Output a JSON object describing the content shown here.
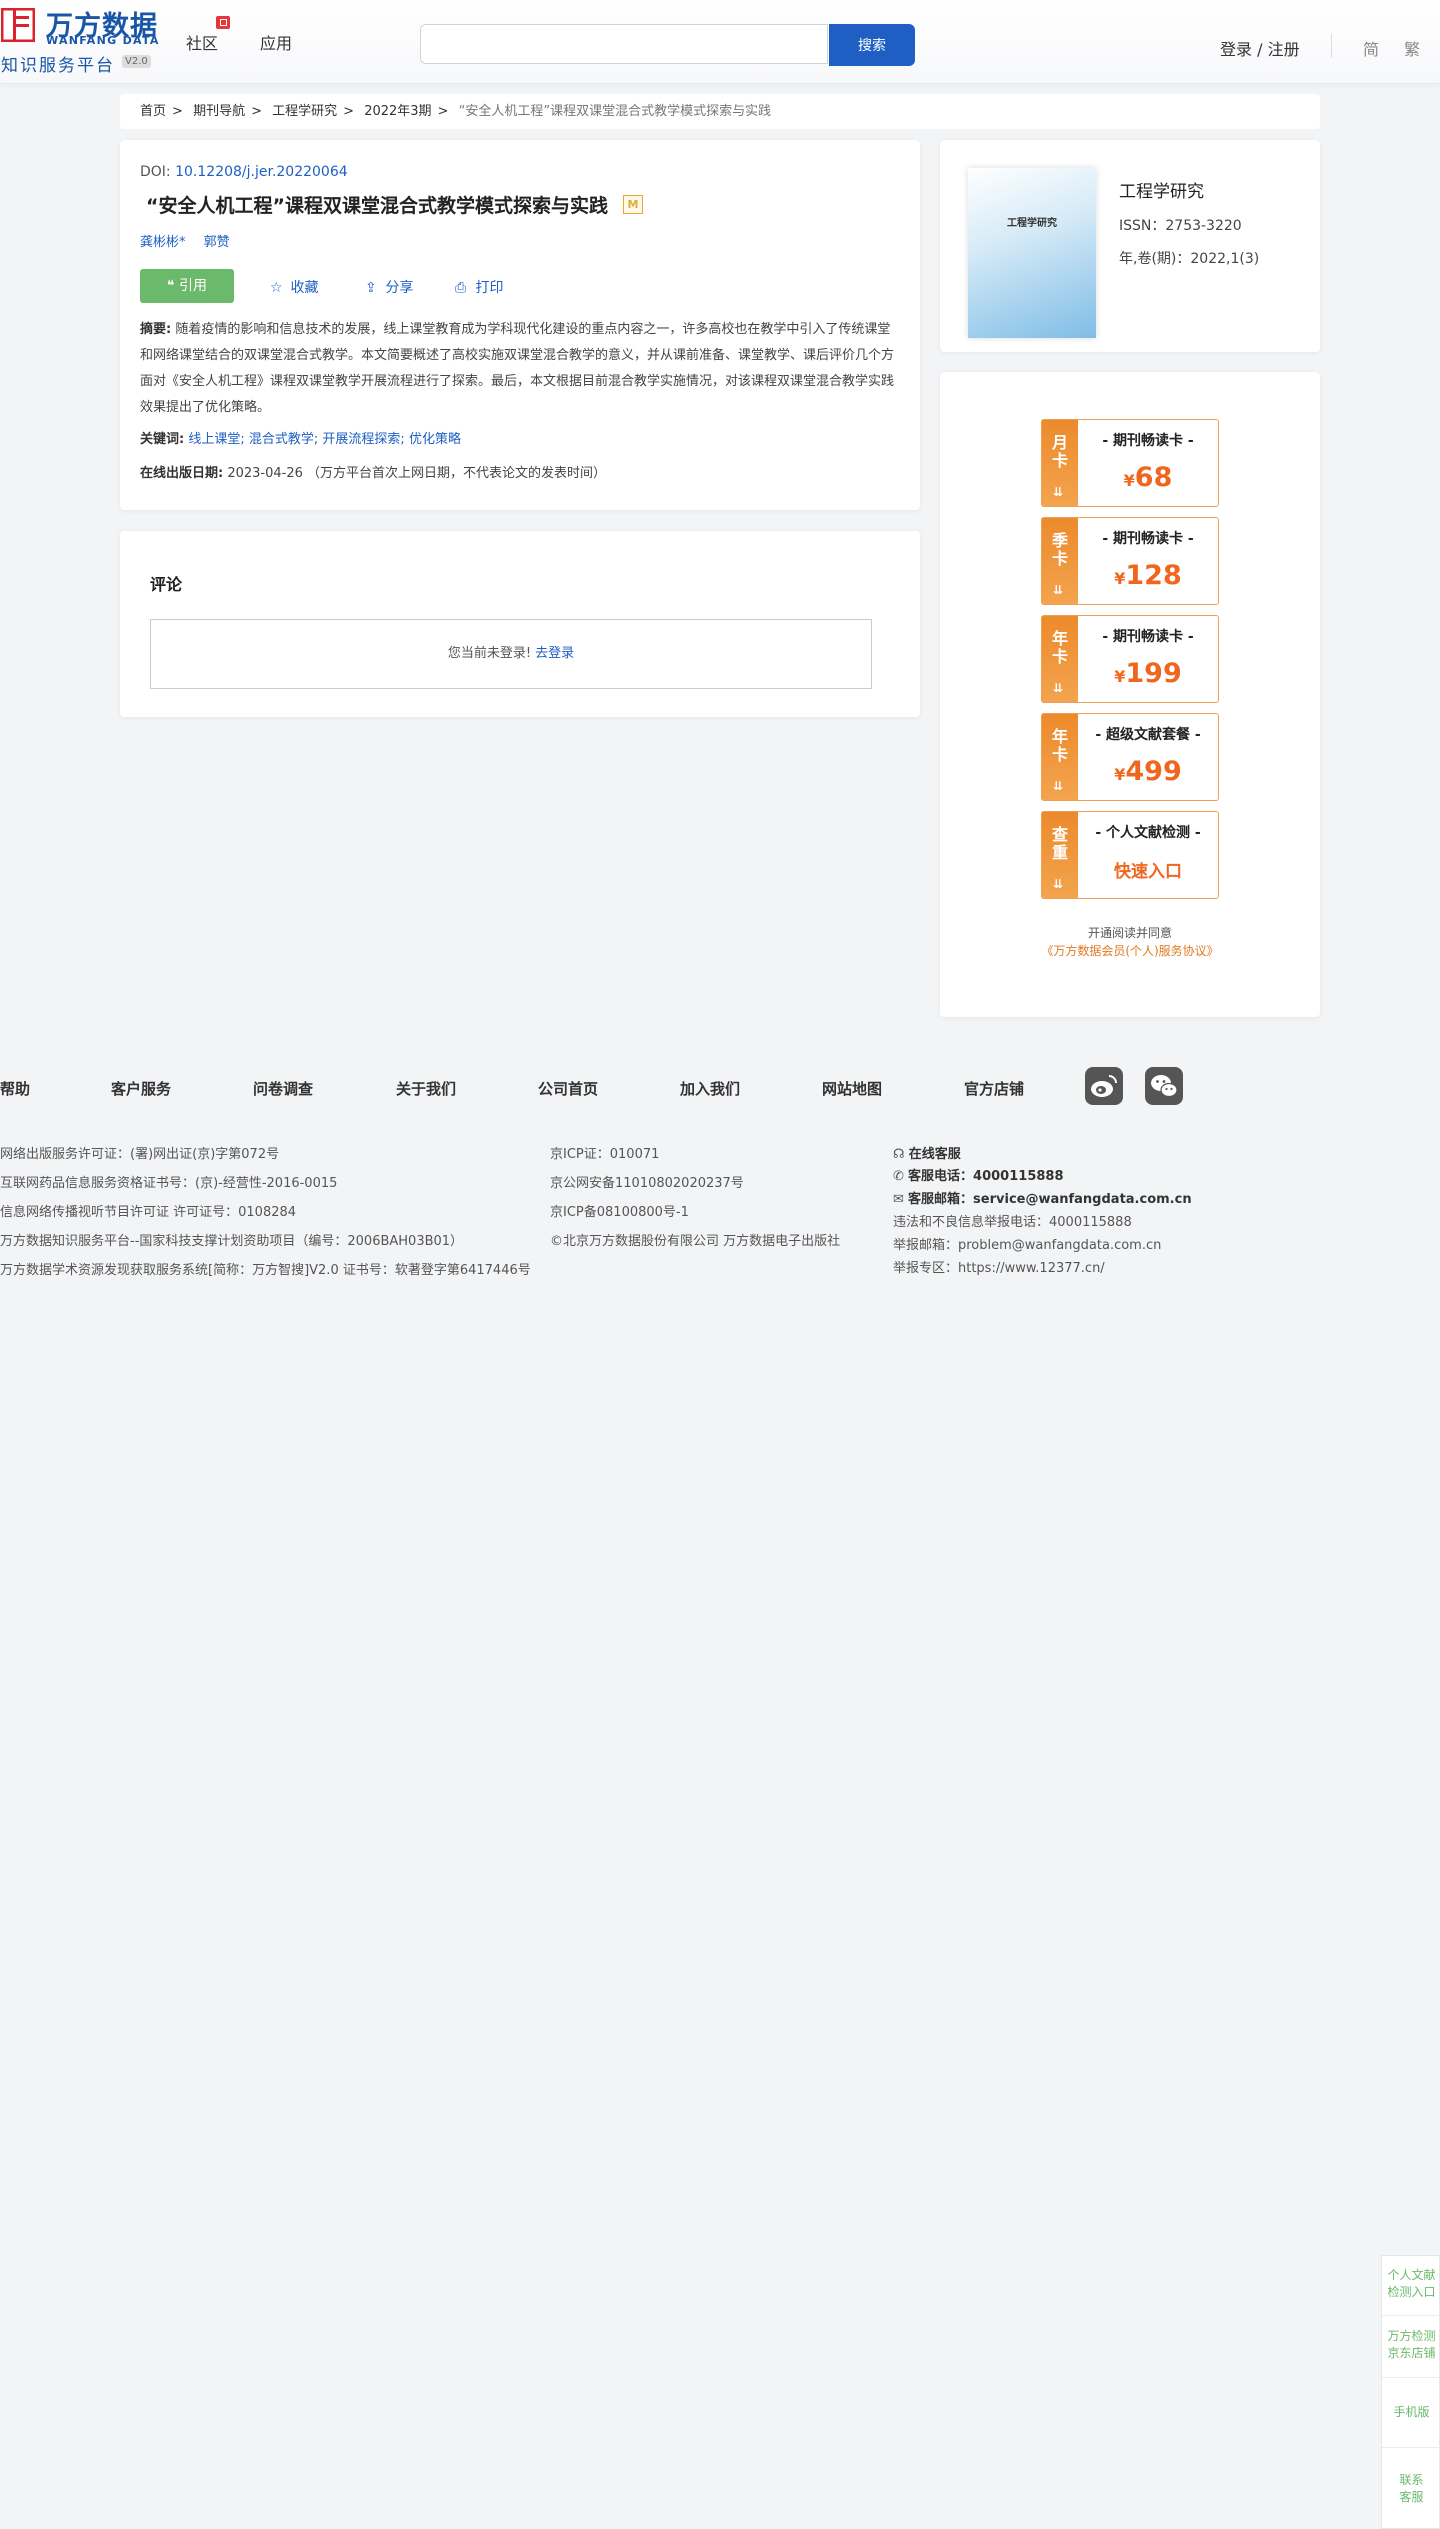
{
  "header": {
    "logo_cn": "万方数据",
    "logo_en": "WANFANG DATA",
    "logo_sub": "知识服务平台",
    "logo_ver": "V2.0",
    "nav": [
      "社区",
      "应用"
    ],
    "search_placeholder": "",
    "search_button": "搜索",
    "login": "登录 / 注册",
    "lang_simplified": "简",
    "lang_traditional": "繁"
  },
  "breadcrumb": {
    "items": [
      "首页",
      "期刊导航",
      "工程学研究",
      "2022年3期"
    ],
    "current": "“安全人机工程”课程双课堂混合式教学模式探索与实践"
  },
  "article": {
    "doi_label": "DOI: ",
    "doi": "10.12208/j.jer.20220064",
    "title": "“安全人机工程”课程双课堂混合式教学模式探索与实践",
    "badge": "M",
    "authors": [
      "龚彬彬*",
      "郭赞"
    ],
    "cite": "引用",
    "actions": [
      "收藏",
      "分享",
      "打印"
    ],
    "abstract_label": "摘要:",
    "abstract": "随着疫情的影响和信息技术的发展，线上课堂教育成为学科现代化建设的重点内容之一，许多高校也在教学中引入了传统课堂和网络课堂结合的双课堂混合式教学。本文简要概述了高校实施双课堂混合教学的意义，并从课前准备、课堂教学、课后评价几个方面对《安全人机工程》课程双课堂教学开展流程进行了探索。最后，本文根据目前混合教学实施情况，对该课程双课堂混合教学实践效果提出了优化策略。",
    "keywords_label": "关键词:",
    "keywords": [
      "线上课堂;",
      "混合式教学;",
      "开展流程探索;",
      "优化策略"
    ],
    "pubdate_label": "在线出版日期:",
    "pubdate": "2023-04-26",
    "pubdate_note": "（万方平台首次上网日期，不代表论文的发表时间）"
  },
  "comment": {
    "title": "评论",
    "not_logged": "您当前未登录!",
    "login_link": "去登录"
  },
  "journal": {
    "cover_title": "工程学研究",
    "name": "工程学研究",
    "issn": "ISSN：2753-3220",
    "volume": "年,卷(期)：2022,1(3)"
  },
  "promos": [
    {
      "side": [
        "月",
        "卡"
      ],
      "name": "- 期刊畅读卡 -",
      "price": "68"
    },
    {
      "side": [
        "季",
        "卡"
      ],
      "name": "- 期刊畅读卡 -",
      "price": "128"
    },
    {
      "side": [
        "年",
        "卡"
      ],
      "name": "- 期刊畅读卡 -",
      "price": "199"
    },
    {
      "side": [
        "年",
        "卡"
      ],
      "name": "- 超级文献套餐 -",
      "price": "499"
    },
    {
      "side": [
        "查",
        "重"
      ],
      "name": "- 个人文献检测 -",
      "quick": "快速入口"
    }
  ],
  "currency": "¥",
  "agreement": {
    "line1": "开通阅读并同意",
    "line2": "《万方数据会员(个人)服务协议》"
  },
  "footer": {
    "nav": [
      "帮助",
      "客户服务",
      "问卷调查",
      "关于我们",
      "公司首页",
      "加入我们",
      "网站地图",
      "官方店铺"
    ],
    "col1": [
      "网络出版服务许可证：(署)网出证(京)字第072号",
      "互联网药品信息服务资格证书号：(京)-经营性-2016-0015",
      "信息网络传播视听节目许可证 许可证号：0108284",
      "万方数据知识服务平台--国家科技支撑计划资助项目（编号：2006BAH03B01）",
      "万方数据学术资源发现获取服务系统[简称：万方智搜]V2.0 证书号：软著登字第6417446号"
    ],
    "col2": [
      "京ICP证：010071",
      "京公网安备11010802020237号",
      "京ICP备08100800号-1",
      "©北京万方数据股份有限公司 万方数据电子出版社"
    ],
    "col3": [
      "在线客服",
      "客服电话：4000115888",
      "客服邮箱：service@wanfangdata.com.cn",
      "违法和不良信息举报电话：4000115888",
      "举报邮箱：problem@wanfangdata.com.cn",
      "举报专区：https://www.12377.cn/"
    ]
  },
  "side_float": [
    [
      "个人文献",
      "检测入口"
    ],
    [
      "万方检测",
      "京东店铺"
    ],
    [
      "手机版"
    ],
    [
      "联系",
      "客服"
    ]
  ],
  "colors": {
    "brand_blue": "#1f5fc4",
    "cite_green": "#6bb96b",
    "promo_orange": "#f0661e"
  }
}
